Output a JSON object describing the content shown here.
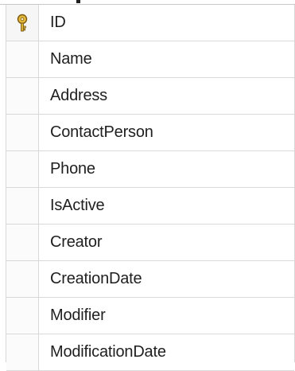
{
  "table": {
    "columns": [
      {
        "name": "ID",
        "primary_key": true,
        "icon": "key-icon"
      },
      {
        "name": "Name",
        "primary_key": false
      },
      {
        "name": "Address",
        "primary_key": false
      },
      {
        "name": "ContactPerson",
        "primary_key": false
      },
      {
        "name": "Phone",
        "primary_key": false
      },
      {
        "name": "IsActive",
        "primary_key": false
      },
      {
        "name": "Creator",
        "primary_key": false
      },
      {
        "name": "CreationDate",
        "primary_key": false
      },
      {
        "name": "Modifier",
        "primary_key": false
      },
      {
        "name": "ModificationDate",
        "primary_key": false
      }
    ]
  },
  "colors": {
    "key_fill": "#e5b93a",
    "key_stroke": "#7a5a10",
    "grid_line": "#d9d9d9",
    "text": "#1f1f1f"
  }
}
